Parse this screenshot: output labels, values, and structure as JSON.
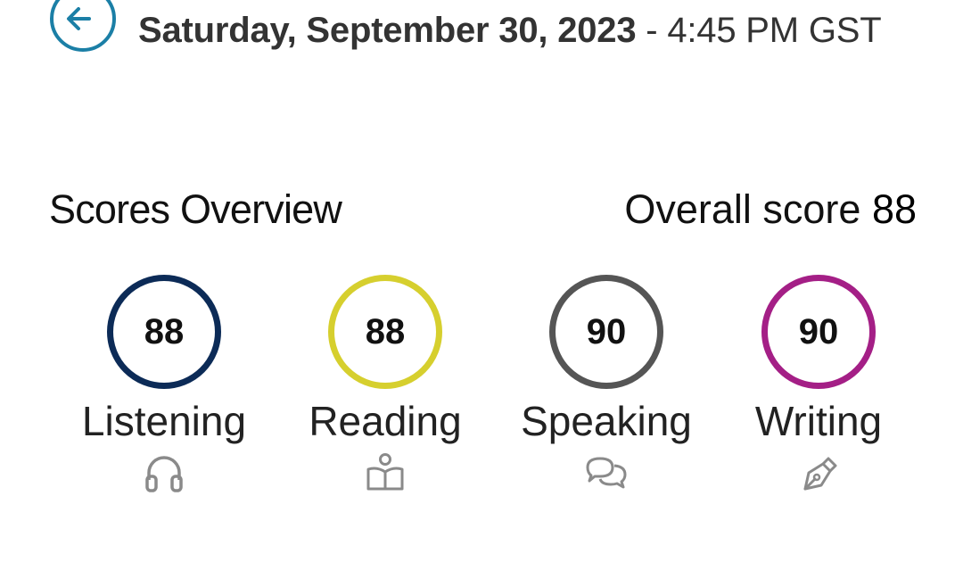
{
  "header": {
    "date": "Saturday, September 30, 2023",
    "separator": " - ",
    "time": "4:45 PM GST",
    "back_icon": "arrow-left-circle-icon",
    "accent_color": "#1b7fa6"
  },
  "overview": {
    "title": "Scores Overview",
    "overall_label": "Overall score ",
    "overall_value": "88"
  },
  "skills": [
    {
      "label": "Listening",
      "score": "88",
      "color": "#0c2b57",
      "icon": "headphones-icon"
    },
    {
      "label": "Reading",
      "score": "88",
      "color": "#d6cf2e",
      "icon": "reading-book-icon"
    },
    {
      "label": "Speaking",
      "score": "90",
      "color": "#555555",
      "icon": "speech-bubbles-icon"
    },
    {
      "label": "Writing",
      "score": "90",
      "color": "#a41f86",
      "icon": "pen-nib-icon"
    }
  ]
}
